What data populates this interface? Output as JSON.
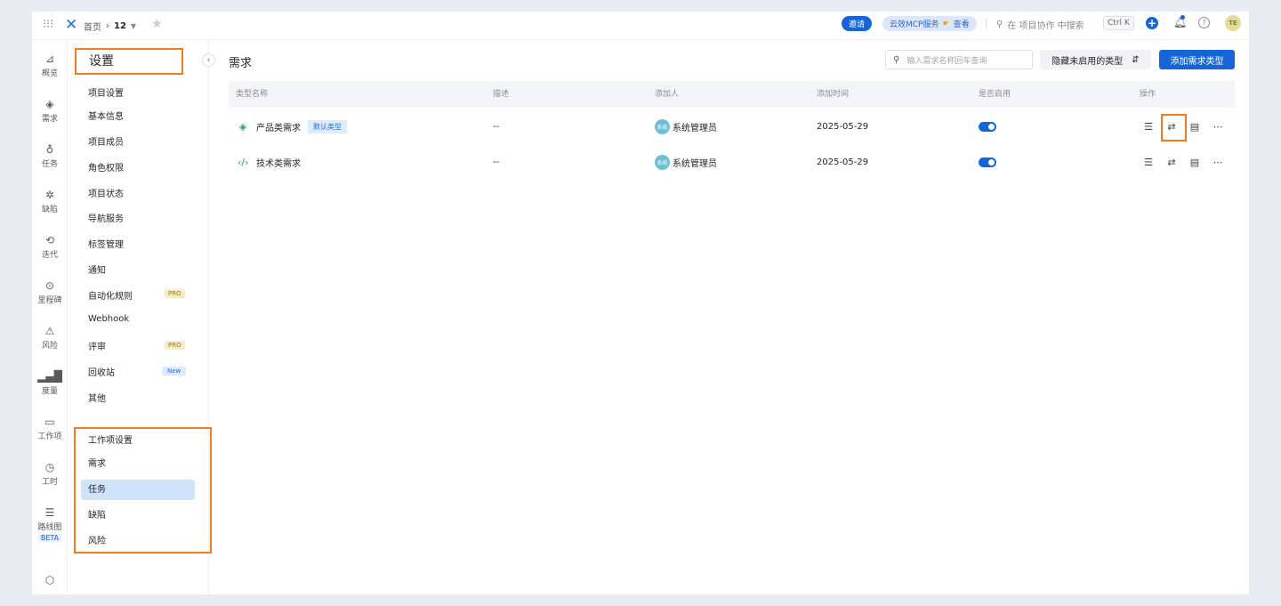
{
  "topbar": {
    "home": "首页",
    "project": "12",
    "invite_label": "邀请",
    "mcp_label": "云效MCP服务",
    "mcp_view": "查看",
    "search_placeholder": "在 项目协作 中搜索",
    "shortcut": "Ctrl K",
    "avatar_initials": "TE"
  },
  "rail": {
    "items": [
      {
        "label": "概览",
        "icon": "chart-icon"
      },
      {
        "label": "需求",
        "icon": "layers-icon"
      },
      {
        "label": "任务",
        "icon": "bulb-icon"
      },
      {
        "label": "缺陷",
        "icon": "bug-icon"
      },
      {
        "label": "迭代",
        "icon": "sprint-icon"
      },
      {
        "label": "里程碑",
        "icon": "location-icon"
      },
      {
        "label": "风险",
        "icon": "warning-icon"
      },
      {
        "label": "度量",
        "icon": "bar-chart-icon"
      },
      {
        "label": "工作项",
        "icon": "folder-icon"
      },
      {
        "label": "工时",
        "icon": "timer-icon"
      },
      {
        "label": "路线图",
        "icon": "roadmap-icon",
        "badge": "BETA"
      }
    ]
  },
  "sidebar": {
    "title": "设置",
    "project_group": "项目设置",
    "project_items": [
      "基本信息",
      "项目成员",
      "角色权限",
      "项目状态",
      "导航服务",
      "标签管理",
      "通知",
      "自动化规则",
      "Webhook",
      "评审",
      "回收站",
      "其他"
    ],
    "pro_tag": "PRO",
    "new_tag": "New",
    "workitem_group": "工作项设置",
    "workitem_items": [
      "需求",
      "任务",
      "缺陷",
      "风险"
    ]
  },
  "main": {
    "title": "需求",
    "search_placeholder": "输入需求名称回车查询",
    "hide_disabled": "隐藏未启用的类型",
    "add_button": "添加需求类型",
    "columns": [
      "类型名称",
      "描述",
      "添加人",
      "添加时间",
      "是否启用",
      "操作"
    ],
    "rows": [
      {
        "name": "产品类需求",
        "tag": "默认类型",
        "desc": "--",
        "avatar": "系统",
        "adder": "系统管理员",
        "date": "2025-05-29",
        "enabled": true
      },
      {
        "name": "技术类需求",
        "tag": "",
        "desc": "--",
        "avatar": "系统",
        "adder": "系统管理员",
        "date": "2025-05-29",
        "enabled": true
      }
    ]
  },
  "colors": {
    "accent": "#1565d8",
    "highlight": "#f07c1e",
    "type_icon": "#21a366"
  }
}
